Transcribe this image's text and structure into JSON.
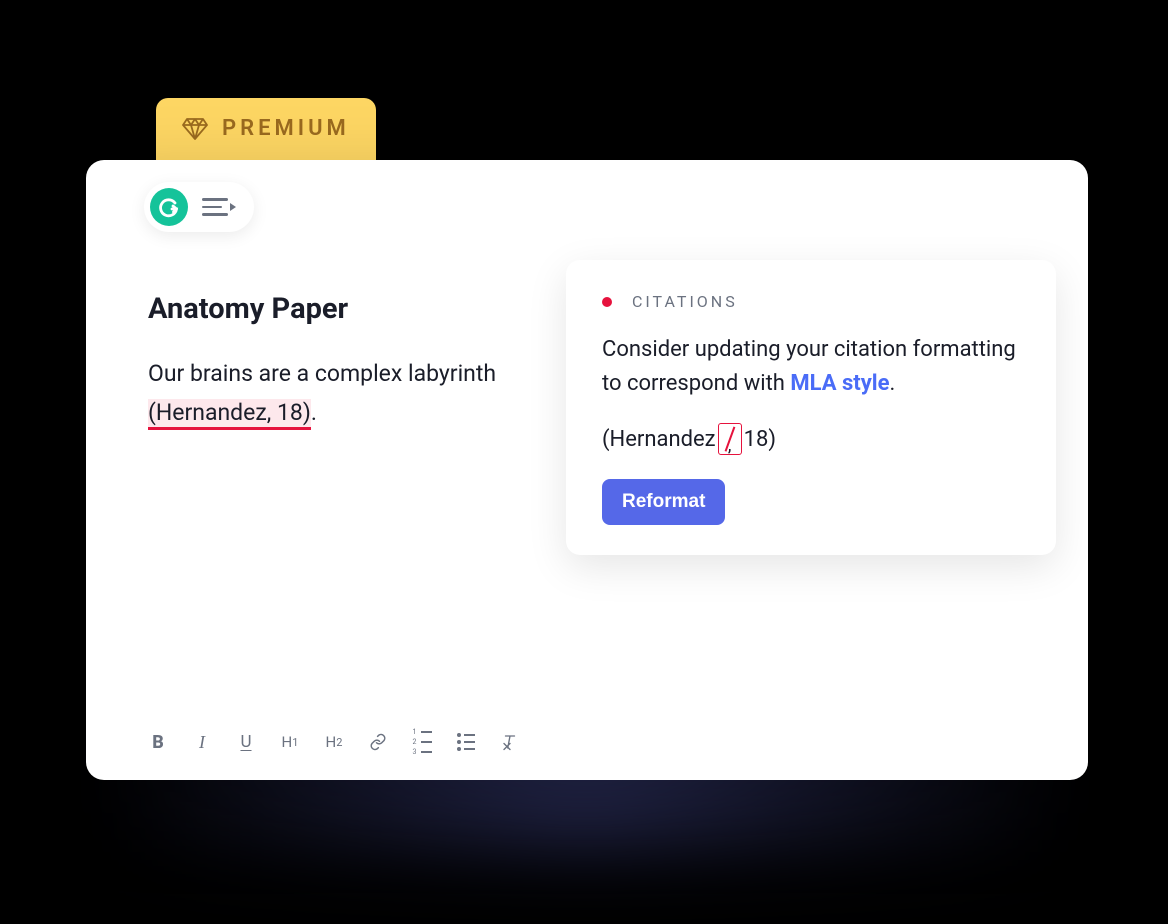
{
  "premium": {
    "label": "PREMIUM"
  },
  "document": {
    "title": "Anatomy Paper",
    "body_prefix": "Our brains are a complex labyrinth ",
    "highlighted_citation": "(Hernandez, 18)",
    "body_suffix": "."
  },
  "suggestion": {
    "category": "CITATIONS",
    "message_part1": "Consider updating your citation formatting to correspond with ",
    "link_text": "MLA style",
    "message_part2": ".",
    "preview_prefix": "(Hernandez",
    "preview_correction_char": ",",
    "preview_suffix": "18)",
    "button_label": "Reformat"
  },
  "format_toolbar": {
    "bold": "B",
    "italic": "I",
    "underline": "U",
    "h1_prefix": "H",
    "h1_sub": "1",
    "h2_prefix": "H",
    "h2_sub": "2"
  }
}
